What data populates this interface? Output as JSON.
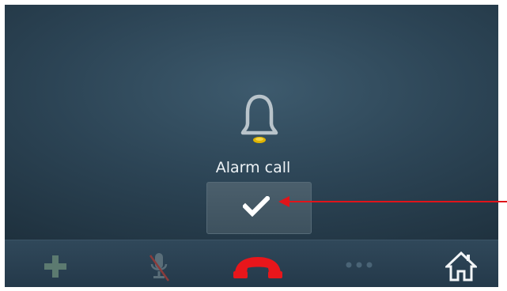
{
  "alarm": {
    "label": "Alarm call",
    "icon": "bell-icon"
  },
  "confirm_button": {
    "icon": "checkmark-icon"
  },
  "bottom_bar": {
    "items": [
      {
        "name": "add-call",
        "icon": "plus-icon"
      },
      {
        "name": "mute",
        "icon": "microphone-muted-icon"
      },
      {
        "name": "hang-up",
        "icon": "phone-hangup-icon"
      },
      {
        "name": "more",
        "icon": "more-dots-icon"
      },
      {
        "name": "home",
        "icon": "home-icon"
      }
    ]
  },
  "colors": {
    "hangup": "#e8161b",
    "annotation_arrow": "#e0141a",
    "disabled_icon": "#5c7a70",
    "bell_glow": "#e0b400"
  }
}
